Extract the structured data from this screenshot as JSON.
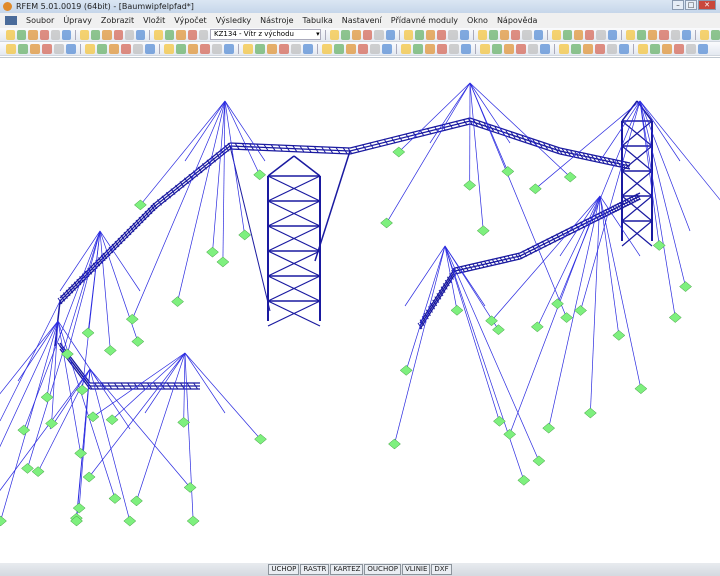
{
  "title": "RFEM 5.01.0019 (64bit) - [Baumwipfelpfad*]",
  "menu": [
    "Soubor",
    "Úpravy",
    "Zobrazit",
    "Vložit",
    "Výpočet",
    "Výsledky",
    "Nástroje",
    "Tabulka",
    "Nastavení",
    "Přídavné moduly",
    "Okno",
    "Nápověda"
  ],
  "load_case": "KZ134 - Vítr z východu",
  "status": [
    "UCHOP",
    "RASTR",
    "KARTEZ",
    "OUCHOP",
    "VLINIE",
    "DXF"
  ],
  "colors": {
    "members": "#1a1aa0",
    "cables": "#2a2ae0",
    "supports": "#7ef07e"
  }
}
